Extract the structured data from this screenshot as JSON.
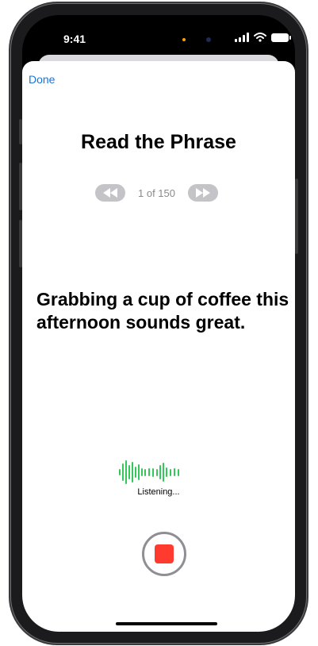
{
  "status": {
    "time": "9:41"
  },
  "nav": {
    "done_label": "Done"
  },
  "title": "Read the Phrase",
  "pager": {
    "counter": "1 of 150"
  },
  "phrase": "Grabbing a cup of coffee this afternoon sounds great.",
  "recording": {
    "status_label": "Listening...",
    "waveform": [
      8,
      22,
      30,
      18,
      26,
      14,
      20,
      10,
      9,
      10,
      11,
      9,
      18,
      24,
      12,
      9,
      10,
      9
    ]
  },
  "colors": {
    "accent": "#1a73d9",
    "wave": "#34c759",
    "stop": "#ff3b30"
  },
  "icons": {
    "back": "rewind-icon",
    "forward": "fast-forward-icon",
    "stop": "stop-icon",
    "wifi": "wifi-icon",
    "battery": "battery-icon",
    "signal": "cellular-signal-icon"
  }
}
